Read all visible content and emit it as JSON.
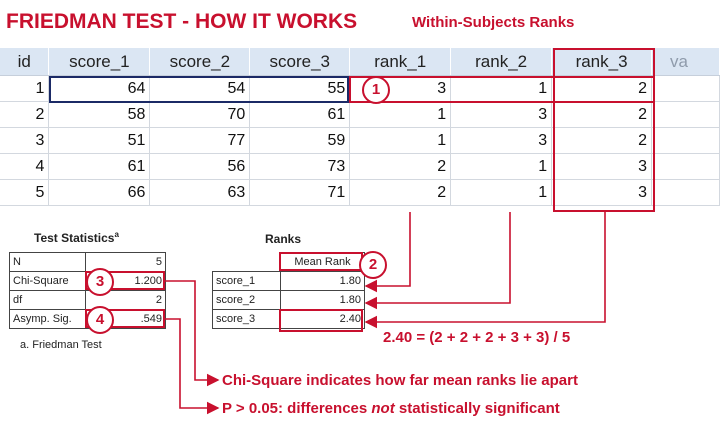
{
  "header": {
    "title": "FRIEDMAN TEST - HOW IT WORKS",
    "subtitle": "Within-Subjects Ranks"
  },
  "grid": {
    "columns": [
      "id",
      "score_1",
      "score_2",
      "score_3",
      "rank_1",
      "rank_2",
      "rank_3",
      "va"
    ],
    "rows": [
      [
        "1",
        "64",
        "54",
        "55",
        "3",
        "1",
        "2"
      ],
      [
        "2",
        "58",
        "70",
        "61",
        "1",
        "3",
        "2"
      ],
      [
        "3",
        "51",
        "77",
        "59",
        "1",
        "3",
        "2"
      ],
      [
        "4",
        "61",
        "56",
        "73",
        "2",
        "1",
        "3"
      ],
      [
        "5",
        "66",
        "63",
        "71",
        "2",
        "1",
        "3"
      ]
    ]
  },
  "test_statistics": {
    "caption": "Test Statistics",
    "superscript": "a",
    "rows": [
      {
        "label": "N",
        "value": "5"
      },
      {
        "label": "Chi-Square",
        "value": "1.200"
      },
      {
        "label": "df",
        "value": "2"
      },
      {
        "label": "Asymp. Sig.",
        "value": ".549"
      }
    ],
    "footnote": "a. Friedman Test"
  },
  "ranks_table": {
    "caption": "Ranks",
    "header": "Mean Rank",
    "rows": [
      {
        "label": "score_1",
        "value": "1.80"
      },
      {
        "label": "score_2",
        "value": "1.80"
      },
      {
        "label": "score_3",
        "value": "2.40"
      }
    ]
  },
  "callouts": {
    "one": "1",
    "two": "2",
    "three": "3",
    "four": "4"
  },
  "notes": {
    "formula": "2.40 = (2 + 2 + 2 + 3 + 3) / 5",
    "chi_square": "Chi-Square indicates how far mean ranks lie apart",
    "p_prefix": "P > 0.05: differences ",
    "p_emph": "not",
    "p_suffix": " statistically significant"
  },
  "colors": {
    "accent": "#c8102e",
    "header_bg": "#dbe6f3",
    "selection": "#1b2a66"
  }
}
